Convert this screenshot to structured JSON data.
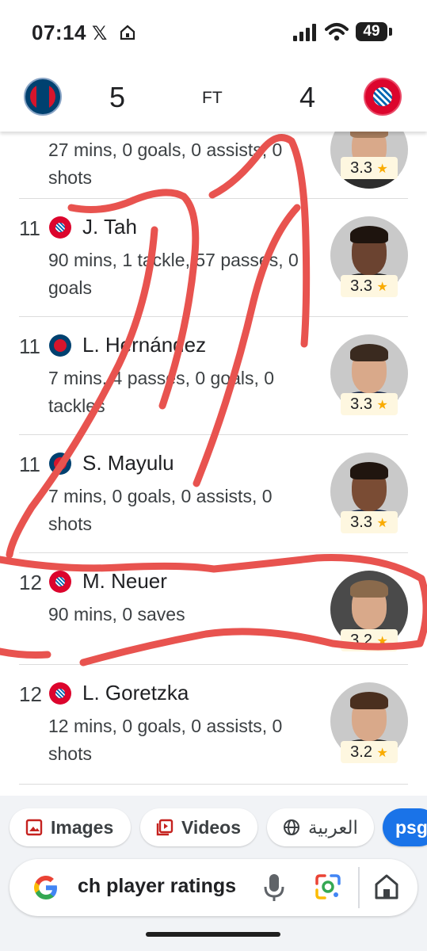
{
  "status_bar": {
    "time": "07:14",
    "x_label": "𝕏",
    "battery": "49"
  },
  "match": {
    "home_score": "5",
    "status": "FT",
    "away_score": "4",
    "home_crest": "psg-crest",
    "away_crest": "fc-bayern-crest"
  },
  "players": [
    {
      "rank": "",
      "name": "",
      "stats": "27 mins, 0 goals, 0 assists, 0 shots",
      "rating": "3.3",
      "team": "none"
    },
    {
      "rank": "11",
      "name": "J. Tah",
      "stats": "90 mins, 1 tackle, 57 passes, 0 goals",
      "rating": "3.3",
      "team": "fcb"
    },
    {
      "rank": "11",
      "name": "L. Hernández",
      "stats": "7 mins, 4 passes, 0 goals, 0 tackles",
      "rating": "3.3",
      "team": "psg"
    },
    {
      "rank": "11",
      "name": "S. Mayulu",
      "stats": "7 mins, 0 goals, 0 assists, 0 shots",
      "rating": "3.3",
      "team": "psg"
    },
    {
      "rank": "12",
      "name": "M. Neuer",
      "stats": "90 mins, 0 saves",
      "rating": "3.2",
      "team": "fcb"
    },
    {
      "rank": "12",
      "name": "L. Goretzka",
      "stats": "12 mins, 0 goals, 0 assists, 0 shots",
      "rating": "3.2",
      "team": "fcb"
    }
  ],
  "rating_star": "★",
  "chips": {
    "images": "Images",
    "videos": "Videos",
    "arabic": "العربية",
    "psg": "psg"
  },
  "search": {
    "query": "ch player ratings"
  },
  "colors": {
    "accent_blue": "#1a73e8",
    "annotation_red": "#e8534f",
    "rating_bg": "#fef7e0",
    "star": "#f9ab00"
  }
}
